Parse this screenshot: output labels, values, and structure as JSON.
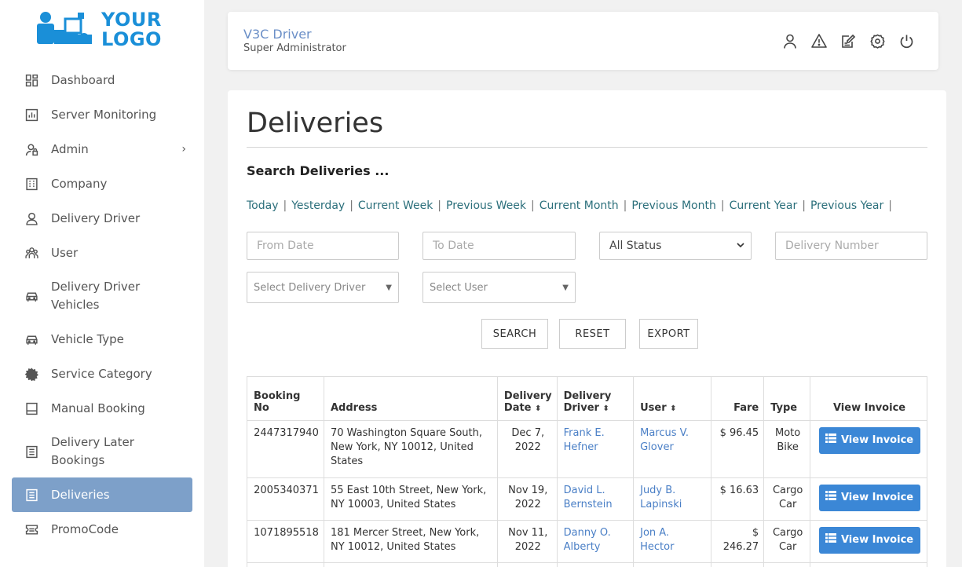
{
  "logo": {
    "line1": "YOUR",
    "line2": "LOGO"
  },
  "sidebar": {
    "items": [
      {
        "label": "Dashboard",
        "icon": "dashboard-icon"
      },
      {
        "label": "Server Monitoring",
        "icon": "chart-icon"
      },
      {
        "label": "Admin",
        "icon": "admin-icon",
        "chevron": "›"
      },
      {
        "label": "Company",
        "icon": "building-icon"
      },
      {
        "label": "Delivery Driver",
        "icon": "driver-icon"
      },
      {
        "label": "User",
        "icon": "users-icon"
      },
      {
        "label": "Delivery Driver Vehicles",
        "icon": "car-icon"
      },
      {
        "label": "Vehicle Type",
        "icon": "car-icon"
      },
      {
        "label": "Service Category",
        "icon": "gear-icon"
      },
      {
        "label": "Manual Booking",
        "icon": "booking-icon"
      },
      {
        "label": "Delivery Later Bookings",
        "icon": "list-icon"
      },
      {
        "label": "Deliveries",
        "icon": "list-icon",
        "active": true
      },
      {
        "label": "PromoCode",
        "icon": "ticket-icon"
      }
    ]
  },
  "header": {
    "name": "V3C Driver",
    "role": "Super Administrator",
    "icons": [
      "user-icon",
      "warning-icon",
      "edit-icon",
      "settings-icon",
      "power-icon"
    ]
  },
  "page": {
    "title": "Deliveries",
    "search_heading": "Search Deliveries ...",
    "quick_links": [
      "Today",
      "Yesterday",
      "Current Week",
      "Previous Week",
      "Current Month",
      "Previous Month",
      "Current Year",
      "Previous Year"
    ],
    "separator": "|"
  },
  "filters": {
    "from_date_placeholder": "From Date",
    "to_date_placeholder": "To Date",
    "status_selected": "All Status",
    "delivery_number_placeholder": "Delivery Number",
    "driver_placeholder": "Select Delivery Driver",
    "user_placeholder": "Select User"
  },
  "buttons": {
    "search": "SEARCH",
    "reset": "RESET",
    "export": "EXPORT"
  },
  "table": {
    "headers": {
      "booking_no": "Booking No",
      "address": "Address",
      "delivery_date_1": "Delivery",
      "delivery_date_2": "Date",
      "delivery_driver_1": "Delivery",
      "delivery_driver_2": "Driver",
      "user": "User",
      "fare": "Fare",
      "type": "Type",
      "view_invoice": "View Invoice"
    },
    "sort_glyph": "⬍",
    "rows": [
      {
        "booking_no": "2447317940",
        "address": "70 Washington Square South, New York, NY 10012, United States",
        "date": "Dec 7, 2022",
        "driver": "Frank E. Hefner",
        "user": "Marcus V. Glover",
        "fare": "$ 96.45",
        "type": "Moto Bike",
        "action": "View Invoice"
      },
      {
        "booking_no": "2005340371",
        "address": "55 East 10th Street, New York, NY 10003, United States",
        "date": "Nov 19, 2022",
        "driver": "David L. Bernstein",
        "user": "Judy B. Lapinski",
        "fare": "$ 16.63",
        "type": "Cargo Car",
        "action": "View Invoice"
      },
      {
        "booking_no": "1071895518",
        "address": "181 Mercer Street, New York, NY 10012, United States",
        "date": "Nov 11, 2022",
        "driver": "Danny O. Alberty",
        "user": "Jon A. Hector",
        "fare": "$ 246.27",
        "type": "Cargo Car",
        "action": "View Invoice"
      }
    ]
  },
  "colors": {
    "accent": "#3b87d6",
    "active_nav": "#7da0c9",
    "link": "#4a7fc6",
    "quick_link": "#2b6f7b",
    "logo": "#1a8fd8"
  }
}
